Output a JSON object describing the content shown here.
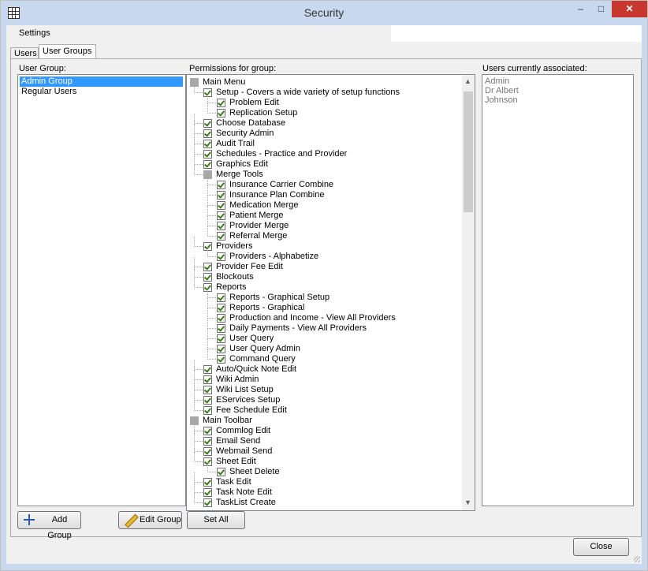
{
  "window": {
    "title": "Security",
    "minimize_glyph": "–",
    "maximize_glyph": "□",
    "close_glyph": "✕"
  },
  "menu": {
    "settings": "Settings"
  },
  "tabs": [
    {
      "label": "Users",
      "active": false
    },
    {
      "label": "User Groups",
      "active": true
    }
  ],
  "user_group": {
    "label": "User Group:",
    "items": [
      {
        "label": "Admin Group",
        "selected": true
      },
      {
        "label": "Regular Users",
        "selected": false
      }
    ]
  },
  "permissions": {
    "label": "Permissions for group:",
    "nodes": [
      {
        "label": "Main Menu",
        "level": 0,
        "kind": "group"
      },
      {
        "label": "Setup - Covers a wide variety of setup functions",
        "level": 1,
        "kind": "checked"
      },
      {
        "label": "Problem Edit",
        "level": 2,
        "kind": "checked"
      },
      {
        "label": "Replication Setup",
        "level": 2,
        "kind": "checked"
      },
      {
        "label": "Choose Database",
        "level": 1,
        "kind": "checked"
      },
      {
        "label": "Security Admin",
        "level": 1,
        "kind": "checked"
      },
      {
        "label": "Audit Trail",
        "level": 1,
        "kind": "checked"
      },
      {
        "label": "Schedules - Practice and Provider",
        "level": 1,
        "kind": "checked"
      },
      {
        "label": "Graphics Edit",
        "level": 1,
        "kind": "checked"
      },
      {
        "label": "Merge Tools",
        "level": 1,
        "kind": "group"
      },
      {
        "label": "Insurance Carrier Combine",
        "level": 2,
        "kind": "checked"
      },
      {
        "label": "Insurance Plan Combine",
        "level": 2,
        "kind": "checked"
      },
      {
        "label": "Medication Merge",
        "level": 2,
        "kind": "checked"
      },
      {
        "label": "Patient Merge",
        "level": 2,
        "kind": "checked"
      },
      {
        "label": "Provider Merge",
        "level": 2,
        "kind": "checked"
      },
      {
        "label": "Referral Merge",
        "level": 2,
        "kind": "checked"
      },
      {
        "label": "Providers",
        "level": 1,
        "kind": "checked"
      },
      {
        "label": "Providers - Alphabetize",
        "level": 2,
        "kind": "checked"
      },
      {
        "label": "Provider Fee Edit",
        "level": 1,
        "kind": "checked"
      },
      {
        "label": "Blockouts",
        "level": 1,
        "kind": "checked"
      },
      {
        "label": "Reports",
        "level": 1,
        "kind": "checked"
      },
      {
        "label": "Reports - Graphical Setup",
        "level": 2,
        "kind": "checked"
      },
      {
        "label": "Reports - Graphical",
        "level": 2,
        "kind": "checked"
      },
      {
        "label": "Production and Income - View All Providers",
        "level": 2,
        "kind": "checked"
      },
      {
        "label": "Daily Payments - View All Providers",
        "level": 2,
        "kind": "checked"
      },
      {
        "label": "User Query",
        "level": 2,
        "kind": "checked"
      },
      {
        "label": "User Query Admin",
        "level": 2,
        "kind": "checked"
      },
      {
        "label": "Command Query",
        "level": 2,
        "kind": "checked"
      },
      {
        "label": "Auto/Quick Note Edit",
        "level": 1,
        "kind": "checked"
      },
      {
        "label": "Wiki Admin",
        "level": 1,
        "kind": "checked"
      },
      {
        "label": "Wiki List Setup",
        "level": 1,
        "kind": "checked"
      },
      {
        "label": "EServices Setup",
        "level": 1,
        "kind": "checked"
      },
      {
        "label": "Fee Schedule Edit",
        "level": 1,
        "kind": "checked"
      },
      {
        "label": "Main Toolbar",
        "level": 0,
        "kind": "group"
      },
      {
        "label": "Commlog Edit",
        "level": 1,
        "kind": "checked"
      },
      {
        "label": "Email Send",
        "level": 1,
        "kind": "checked"
      },
      {
        "label": "Webmail Send",
        "level": 1,
        "kind": "checked"
      },
      {
        "label": "Sheet Edit",
        "level": 1,
        "kind": "checked"
      },
      {
        "label": "Sheet Delete",
        "level": 2,
        "kind": "checked"
      },
      {
        "label": "Task Edit",
        "level": 1,
        "kind": "checked"
      },
      {
        "label": "Task Note Edit",
        "level": 1,
        "kind": "checked"
      },
      {
        "label": "TaskList Create",
        "level": 1,
        "kind": "checked"
      }
    ]
  },
  "users_associated": {
    "label": "Users currently associated:",
    "items": [
      "Admin",
      "Dr Albert",
      "Johnson"
    ]
  },
  "buttons": {
    "add_group": "Add Group",
    "edit_group": "Edit Group",
    "set_all": "Set All",
    "close": "Close"
  },
  "icons": {
    "app": "security-grid-icon",
    "add": "plus-icon",
    "edit": "pencil-icon"
  },
  "colors": {
    "selection": "#3399ff",
    "close_button": "#c7372f",
    "titlebar": "#c8d8ee"
  }
}
